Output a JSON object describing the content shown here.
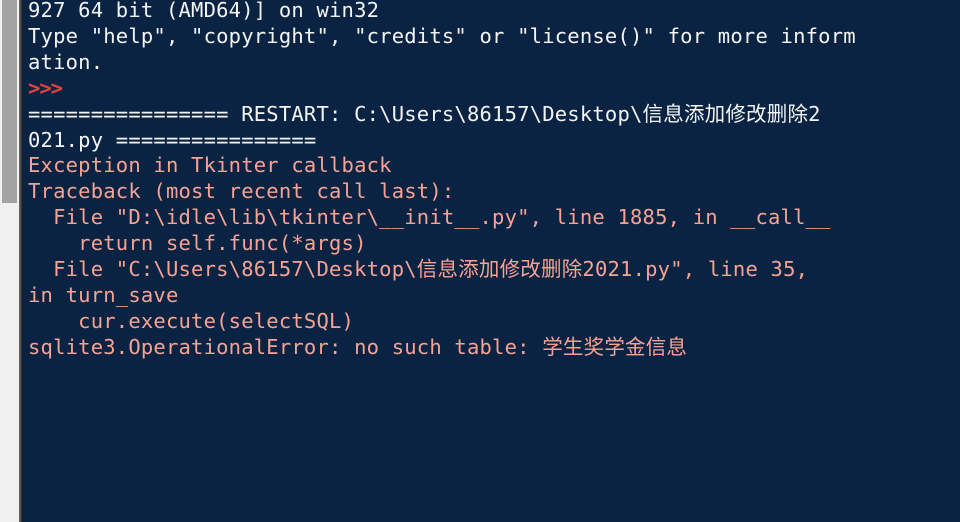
{
  "window": {
    "app": "Python IDLE Shell",
    "background_color": "#0a2342",
    "output_text_color": "#f4f4f4",
    "error_text_color": "#f6a394",
    "prompt_color": "#e8433a"
  },
  "scrollbar": {
    "name": "vertical-scrollbar",
    "track_color": "#f0f0f0",
    "thumb_color": "#a3a3a3",
    "thumb_top": 0,
    "thumb_height": 203
  },
  "console": {
    "lines": [
      {
        "id": "banner-version",
        "kind": "out",
        "text": "927 64 bit (AMD64)] on win32"
      },
      {
        "id": "banner-help",
        "kind": "out",
        "text": "Type \"help\", \"copyright\", \"credits\" or \"license()\" for more inform"
      },
      {
        "id": "banner-help-wrap",
        "kind": "out",
        "text": "ation."
      },
      {
        "id": "prompt",
        "kind": "prompt",
        "text": ">>>"
      },
      {
        "id": "restart-line-1",
        "kind": "out",
        "text": "================ RESTART: C:\\Users\\86157\\Desktop\\信息添加修改删除2"
      },
      {
        "id": "restart-line-2",
        "kind": "out",
        "text": "021.py ================"
      },
      {
        "id": "exception-header",
        "kind": "err",
        "text": "Exception in Tkinter callback"
      },
      {
        "id": "traceback-header",
        "kind": "err",
        "text": "Traceback (most recent call last):"
      },
      {
        "id": "frame-1-file",
        "kind": "err",
        "text": "  File \"D:\\idle\\lib\\tkinter\\__init__.py\", line 1885, in __call__"
      },
      {
        "id": "frame-1-source",
        "kind": "err",
        "text": "    return self.func(*args)"
      },
      {
        "id": "frame-2-file",
        "kind": "err",
        "text": "  File \"C:\\Users\\86157\\Desktop\\信息添加修改删除2021.py\", line 35,"
      },
      {
        "id": "frame-2-file-wrap",
        "kind": "err",
        "text": "in turn_save"
      },
      {
        "id": "frame-2-source",
        "kind": "err",
        "text": "    cur.execute(selectSQL)"
      },
      {
        "id": "error-message",
        "kind": "err",
        "text": "sqlite3.OperationalError: no such table: 学生奖学金信息"
      }
    ]
  }
}
